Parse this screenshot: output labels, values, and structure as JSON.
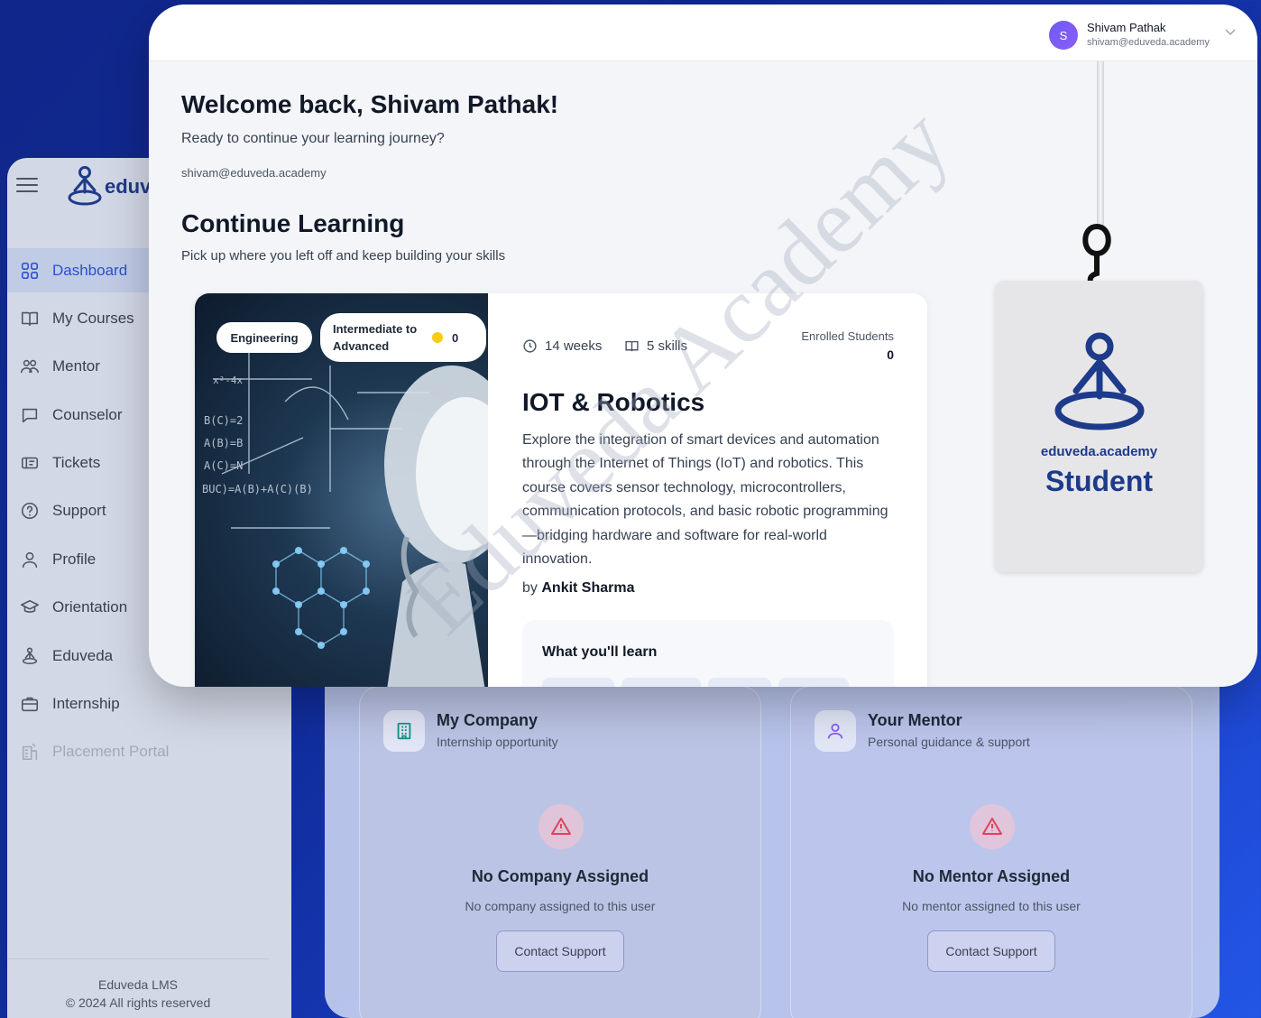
{
  "brand": {
    "logo_text": "eduv"
  },
  "sidebar": {
    "items": [
      {
        "label": "Dashboard",
        "icon": "grid-icon",
        "active": true
      },
      {
        "label": "My Courses",
        "icon": "book-icon"
      },
      {
        "label": "Mentor",
        "icon": "users-icon"
      },
      {
        "label": "Counselor",
        "icon": "chat-icon"
      },
      {
        "label": "Tickets",
        "icon": "ticket-icon"
      },
      {
        "label": "Support",
        "icon": "help-icon"
      },
      {
        "label": "Profile",
        "icon": "user-icon"
      },
      {
        "label": "Orientation",
        "icon": "graduation-cap-icon"
      },
      {
        "label": "Eduveda",
        "icon": "meditation-icon"
      },
      {
        "label": "Internship",
        "icon": "briefcase-icon"
      },
      {
        "label": "Placement Portal",
        "icon": "building-icon",
        "disabled": true
      }
    ],
    "footer_line1": "Eduveda LMS",
    "footer_line2": "© 2024 All rights reserved"
  },
  "user": {
    "initial": "S",
    "name": "Shivam Pathak",
    "email": "shivam@eduveda.academy"
  },
  "welcome": {
    "title": "Welcome back, Shivam Pathak!",
    "subtitle": "Ready to continue your learning journey?",
    "email": "shivam@eduveda.academy"
  },
  "continue": {
    "title": "Continue Learning",
    "subtitle": "Pick up where you left off and keep building your skills"
  },
  "course": {
    "category": "Engineering",
    "level": "Intermediate to Advanced",
    "rating": "0",
    "duration": "14 weeks",
    "skills": "5 skills",
    "enrolled_label": "Enrolled Students",
    "enrolled_count": "0",
    "title": "IOT & Robotics",
    "description": "Explore the integration of smart devices and automation through the Internet of Things (IoT) and robotics. This course covers sensor technology, microcontrollers, communication protocols, and basic robotic programming—bridging hardware and software for real-world innovation.",
    "by_prefix": "by",
    "instructor": "Ankit Sharma",
    "learn_title": "What you'll learn"
  },
  "id_card": {
    "domain": "eduveda.academy",
    "role": "Student"
  },
  "company_card": {
    "title": "My Company",
    "subtitle": "Internship opportunity",
    "empty_title": "No Company Assigned",
    "empty_sub": "No company assigned to this user",
    "button": "Contact Support"
  },
  "mentor_card": {
    "title": "Your Mentor",
    "subtitle": "Personal guidance & support",
    "empty_title": "No Mentor Assigned",
    "empty_sub": "No mentor assigned to this user",
    "button": "Contact Support"
  },
  "watermark": "Eduveda Academy",
  "colors": {
    "accent": "#2b4fcf",
    "brand_navy": "#1e3a8a",
    "background": "#10268a",
    "warning": "#e0435e"
  }
}
